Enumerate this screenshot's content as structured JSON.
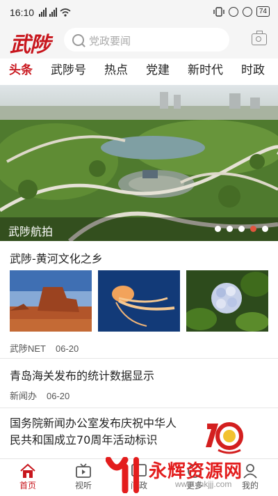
{
  "status_bar": {
    "time": "16:10",
    "battery": "74"
  },
  "header": {
    "logo": "武陟",
    "search_placeholder": "党政要闻"
  },
  "tabs": [
    {
      "label": "头条",
      "active": true
    },
    {
      "label": "武陟号"
    },
    {
      "label": "热点"
    },
    {
      "label": "党建"
    },
    {
      "label": "新时代"
    },
    {
      "label": "时政"
    }
  ],
  "banner": {
    "title": "武陟航拍",
    "slide_count": 5,
    "active_slide": 4
  },
  "articles": [
    {
      "title": "武陟-黄河文化之乡",
      "source": "武陟NET",
      "date": "06-20"
    },
    {
      "title": "青岛海关发布的统计数据显示",
      "source": "新闻办",
      "date": "06-20"
    },
    {
      "title": "国务院新闻办公室发布庆祝中华人民共和国成立70周年活动标识"
    }
  ],
  "bottom_nav": [
    {
      "label": "首页",
      "icon": "home-icon",
      "active": true
    },
    {
      "label": "视听",
      "icon": "tv-icon"
    },
    {
      "label": "问政",
      "icon": "question-icon"
    },
    {
      "label": "更多",
      "icon": "more-icon"
    },
    {
      "label": "我的",
      "icon": "user-icon"
    }
  ],
  "watermark": {
    "text": "永辉资源网",
    "url": "www.yhkjjj.com"
  },
  "colors": {
    "brand_red": "#c8161d",
    "watermark_red": "#e31d1d"
  }
}
